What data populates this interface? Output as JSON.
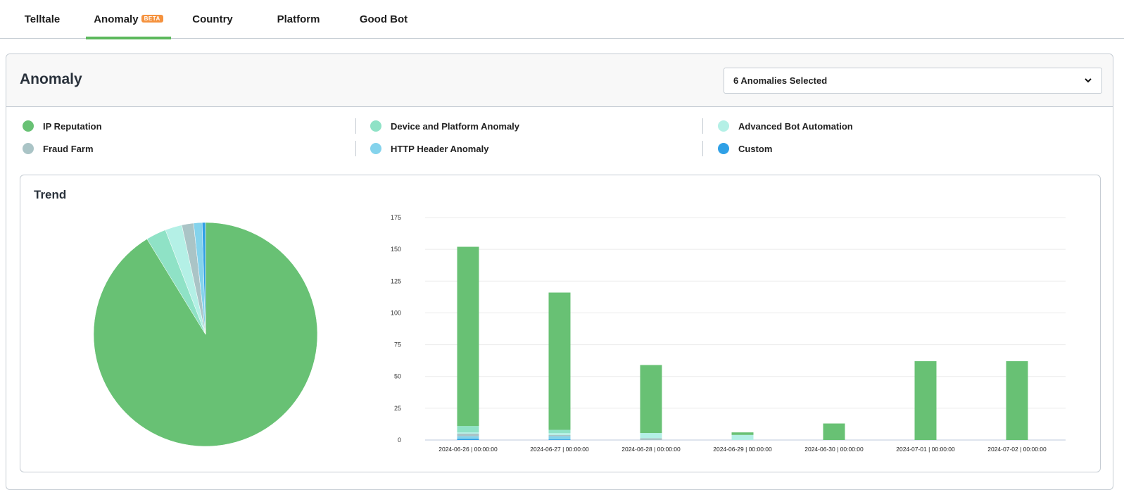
{
  "tabs": [
    {
      "label": "Telltale",
      "active": false
    },
    {
      "label": "Anomaly",
      "active": true,
      "badge": "BETA"
    },
    {
      "label": "Country",
      "active": false
    },
    {
      "label": "Platform",
      "active": false
    },
    {
      "label": "Good Bot",
      "active": false
    }
  ],
  "panel": {
    "title": "Anomaly",
    "select_value": "6 Anomalies Selected",
    "select_icon": "chevron-down-icon"
  },
  "legend": [
    {
      "label": "IP Reputation",
      "color": "#68c174"
    },
    {
      "label": "Device and Platform Anomaly",
      "color": "#8fe2c6"
    },
    {
      "label": "Advanced Bot Automation",
      "color": "#b4f0e6"
    },
    {
      "label": "Fraud Farm",
      "color": "#aac4c6"
    },
    {
      "label": "HTTP Header Anomaly",
      "color": "#84d3ec"
    },
    {
      "label": "Custom",
      "color": "#2fa0e6"
    }
  ],
  "trend": {
    "title": "Trend"
  },
  "chart_data": [
    {
      "type": "pie",
      "title": "",
      "labels": [
        "IP Reputation",
        "Device and Platform Anomaly",
        "Advanced Bot Automation",
        "Fraud Farm",
        "HTTP Header Anomaly",
        "Custom"
      ],
      "values": [
        375,
        12,
        10,
        7,
        5,
        2
      ],
      "colors": [
        "#68c174",
        "#8fe2c6",
        "#b4f0e6",
        "#aac4c6",
        "#84d3ec",
        "#2fa0e6"
      ],
      "start": "12 o'clock",
      "direction": "clockwise"
    },
    {
      "type": "bar",
      "stacked": true,
      "title": "",
      "xlabel": "",
      "ylabel": "",
      "categories": [
        "2024-06-26 | 00:00:00",
        "2024-06-27 | 00:00:00",
        "2024-06-28 | 00:00:00",
        "2024-06-29 | 00:00:00",
        "2024-06-30 | 00:00:00",
        "2024-07-01 | 00:00:00",
        "2024-07-02 | 00:00:00"
      ],
      "series": [
        {
          "name": "Custom",
          "color": "#2fa0e6",
          "values": [
            1,
            0.5,
            0,
            0,
            0,
            0,
            0
          ]
        },
        {
          "name": "HTTP Header Anomaly",
          "color": "#84d3ec",
          "values": [
            2,
            2.5,
            0,
            0,
            0,
            0,
            0
          ]
        },
        {
          "name": "Fraud Farm",
          "color": "#aac4c6",
          "values": [
            2,
            1,
            1.5,
            0,
            0,
            0,
            0
          ]
        },
        {
          "name": "Advanced Bot Automation",
          "color": "#b4f0e6",
          "values": [
            1,
            1.5,
            4,
            4,
            0,
            0,
            0
          ]
        },
        {
          "name": "Device and Platform Anomaly",
          "color": "#8fe2c6",
          "values": [
            5,
            2.5,
            0,
            0,
            0,
            0,
            0
          ]
        },
        {
          "name": "IP Reputation",
          "color": "#68c174",
          "values": [
            141,
            108,
            53.5,
            2,
            13,
            62,
            62
          ]
        }
      ],
      "ylim": [
        0,
        175
      ],
      "yticks": [
        0,
        25,
        50,
        75,
        100,
        125,
        150,
        175
      ],
      "grid": true,
      "legend": "none"
    }
  ]
}
